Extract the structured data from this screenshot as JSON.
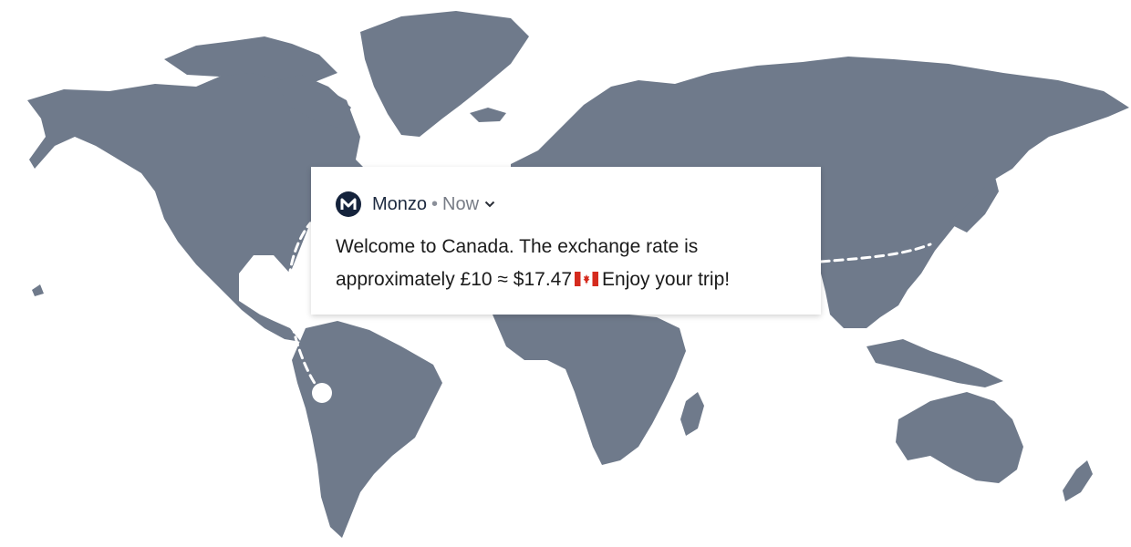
{
  "colors": {
    "land": "#6f7a8b",
    "brand": "#15233c",
    "flag_red": "#d52b1e"
  },
  "map": {
    "icon": "world-map"
  },
  "notification": {
    "app_icon": "monzo-logo-icon",
    "app_name": "Monzo",
    "separator": "•",
    "time": "Now",
    "expand_icon": "chevron-down-icon",
    "message_part1": "Welcome to Canada. The exchange rate is approximately £10 ≈ $17.47",
    "flag_icon": "canada-flag-icon",
    "message_part2": "Enjoy your trip!"
  }
}
